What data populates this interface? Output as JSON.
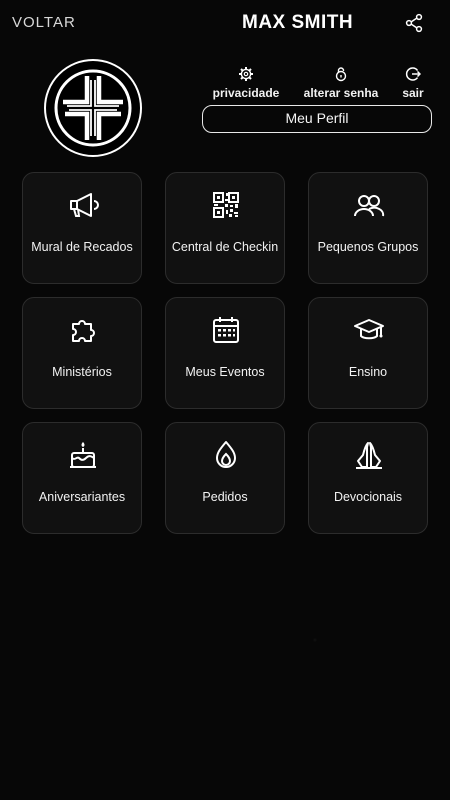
{
  "header": {
    "back_label": "VOLTAR",
    "user_name": "MAX SMITH",
    "share_icon": "share-icon"
  },
  "profile": {
    "logo_icon": "church-cross-logo",
    "actions": [
      {
        "label": "privacidade",
        "icon": "gear-icon"
      },
      {
        "label": "alterar senha",
        "icon": "lock-icon"
      },
      {
        "label": "sair",
        "icon": "logout-icon"
      }
    ],
    "my_profile_label": "Meu Perfil"
  },
  "menu": [
    {
      "label": "Mural de Recados",
      "icon": "megaphone-icon"
    },
    {
      "label": "Central de Checkin",
      "icon": "qr-code-icon"
    },
    {
      "label": "Pequenos Grupos",
      "icon": "group-icon"
    },
    {
      "label": "Ministérios",
      "icon": "puzzle-icon"
    },
    {
      "label": "Meus Eventos",
      "icon": "calendar-icon"
    },
    {
      "label": "Ensino",
      "icon": "graduation-cap-icon"
    },
    {
      "label": "Aniversariantes",
      "icon": "birthday-cake-icon"
    },
    {
      "label": "Pedidos",
      "icon": "flame-icon"
    },
    {
      "label": "Devocionais",
      "icon": "praying-hands-icon"
    }
  ],
  "colors": {
    "background": "#070707",
    "tile": "#111111",
    "tile_border": "#2c2c2c",
    "text": "#ffffff"
  }
}
